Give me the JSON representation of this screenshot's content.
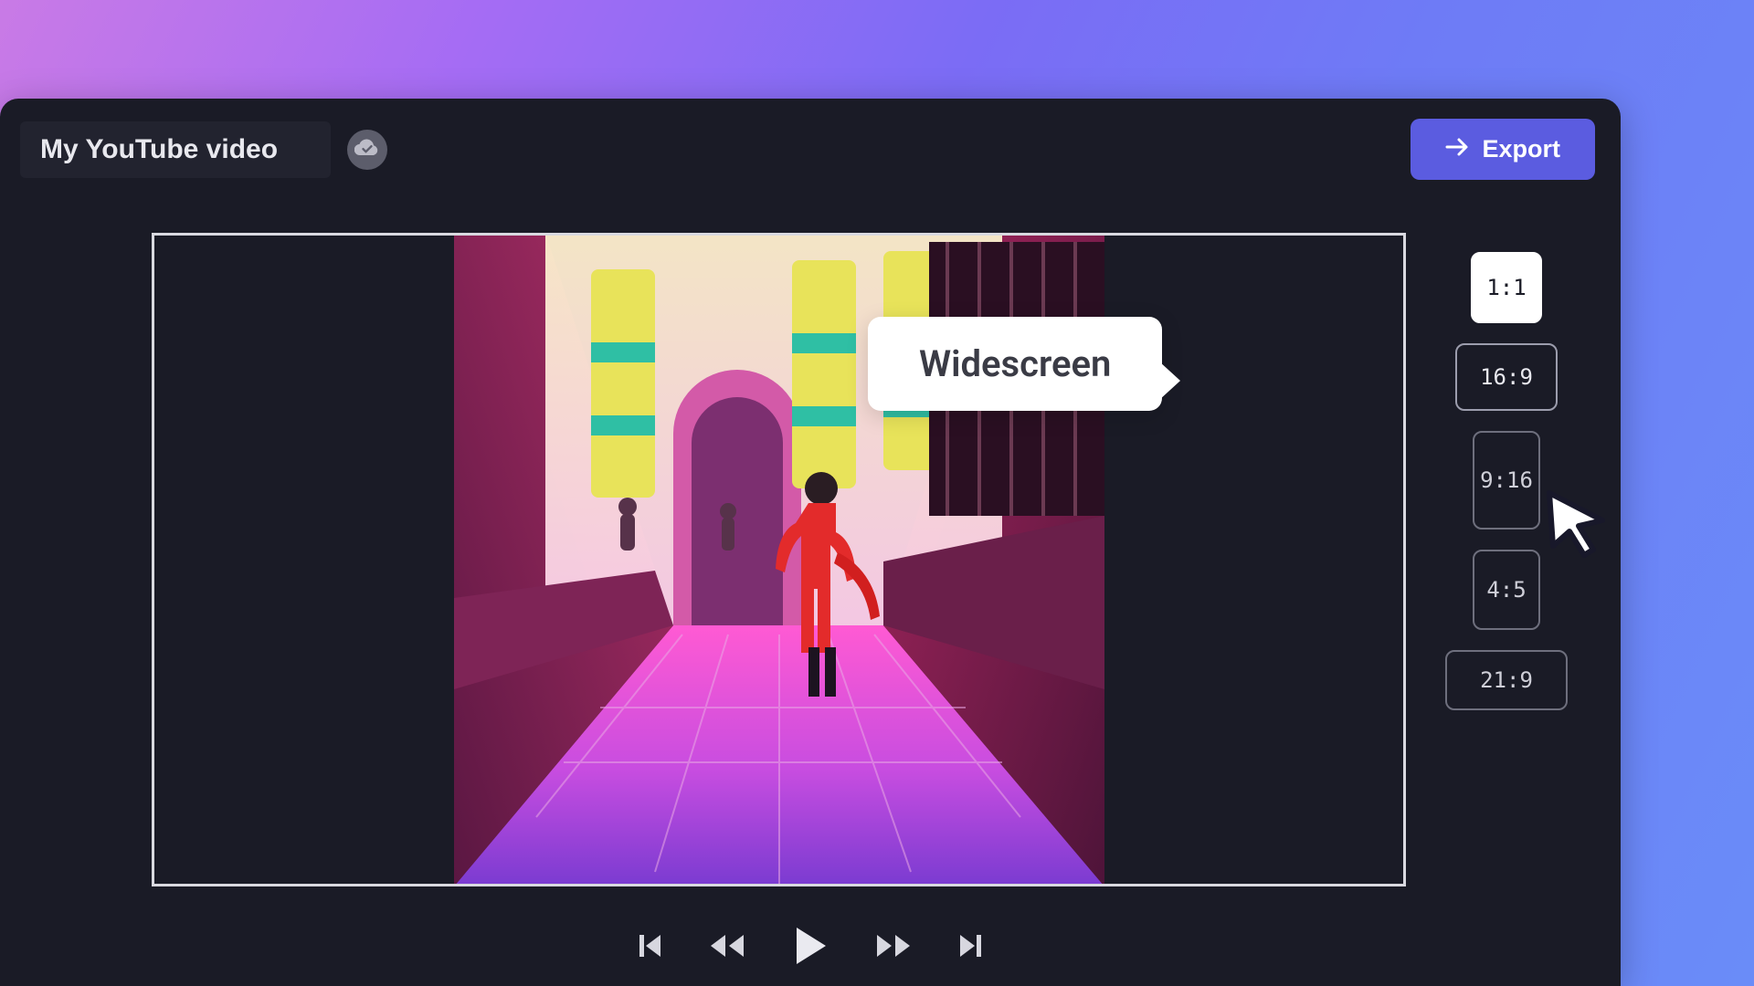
{
  "header": {
    "project_title": "My YouTube video",
    "cloud_status_icon": "cloud-check-icon",
    "export_label": "Export"
  },
  "aspect_ratios": {
    "options": [
      {
        "label": "1:1",
        "css": "r-1-1"
      },
      {
        "label": "16:9",
        "css": "r-16-9"
      },
      {
        "label": "9:16",
        "css": "r-9-16"
      },
      {
        "label": "4:5",
        "css": "r-4-5"
      },
      {
        "label": "21:9",
        "css": "r-21-9"
      }
    ],
    "tooltip_label": "Widescreen",
    "hovered": "16:9"
  },
  "player_controls": {
    "skip_start_icon": "skip-start-icon",
    "rewind_icon": "rewind-icon",
    "play_icon": "play-icon",
    "forward_icon": "fast-forward-icon",
    "skip_end_icon": "skip-end-icon"
  },
  "colors": {
    "accent": "#5b5ce0",
    "panel_bg": "#1a1b26"
  }
}
